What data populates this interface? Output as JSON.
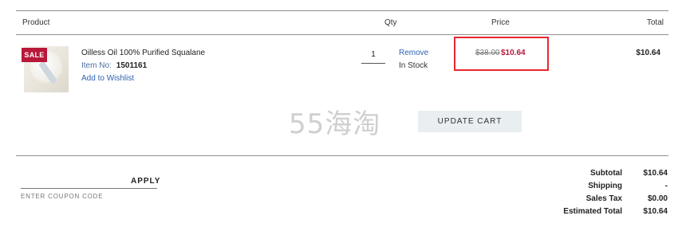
{
  "table_header": {
    "product": "Product",
    "qty": "Qty",
    "price": "Price",
    "total": "Total"
  },
  "item": {
    "sale_badge": "SALE",
    "name": "Oilless Oil 100% Purified Squalane",
    "item_no_label": "Item No:",
    "item_no": "1501161",
    "wishlist_label": "Add to Wishlist",
    "quantity": "1",
    "remove_label": "Remove",
    "stock_status": "In Stock",
    "original_price": "$38.00",
    "sale_price": "$10.64",
    "line_total": "$10.64"
  },
  "watermark": "55海淘",
  "update_cart_label": "UPDATE CART",
  "coupon": {
    "apply_label": "APPLY",
    "placeholder": "ENTER COUPON CODE"
  },
  "summary": [
    {
      "label": "Subtotal",
      "value": "$10.64"
    },
    {
      "label": "Shipping",
      "value": "-"
    },
    {
      "label": "Sales Tax",
      "value": "$0.00"
    },
    {
      "label": "Estimated Total",
      "value": "$10.64"
    }
  ],
  "colors": {
    "sale": "#b8173a",
    "link": "#2f63b4",
    "highlight": "#e8262e",
    "button_bg": "#e9eef1"
  }
}
